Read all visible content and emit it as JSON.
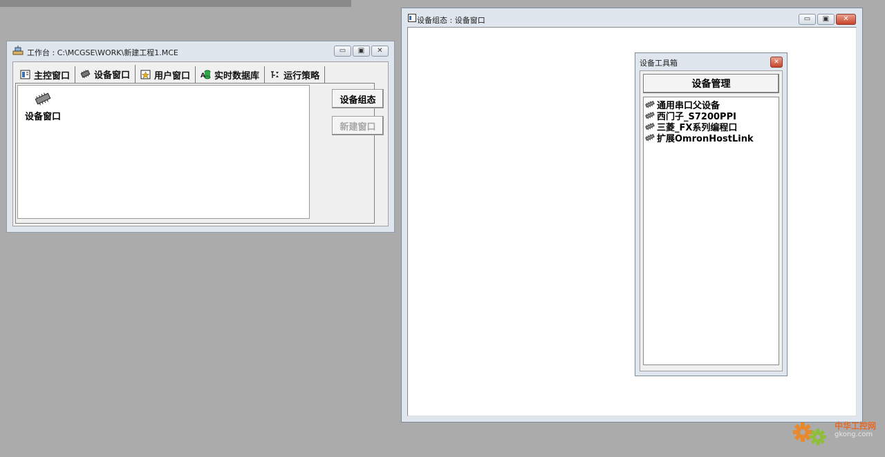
{
  "workbench": {
    "title": "工作台 : C:\\MCGSE\\WORK\\新建工程1.MCE",
    "tabs": [
      {
        "label": "主控窗口",
        "icon": "main-window-icon"
      },
      {
        "label": "设备窗口",
        "icon": "chip-icon"
      },
      {
        "label": "用户窗口",
        "icon": "user-window-icon"
      },
      {
        "label": "实时数据库",
        "icon": "database-icon"
      },
      {
        "label": "运行策略",
        "icon": "strategy-icon"
      }
    ],
    "active_tab": "设备窗口",
    "items": [
      {
        "label": "设备窗口",
        "icon": "chip-icon"
      }
    ],
    "buttons": {
      "device_config": "设备组态",
      "new_window": "新建窗口"
    }
  },
  "device_config_window": {
    "title": "设备组态 : 设备窗口"
  },
  "toolbox": {
    "title": "设备工具箱",
    "manage_button": "设备管理",
    "devices": [
      "通用串口父设备",
      "西门子_S7200PPI",
      "三菱_FX系列编程口",
      "扩展OmronHostLink"
    ]
  },
  "watermark": {
    "name": "中华工控网",
    "url": "gkong.com"
  },
  "colors": {
    "desktop": "#ababab",
    "window_frame": "#dfe6ee",
    "close_red": "#c8432a",
    "watermark_orange": "#e46a2a"
  }
}
